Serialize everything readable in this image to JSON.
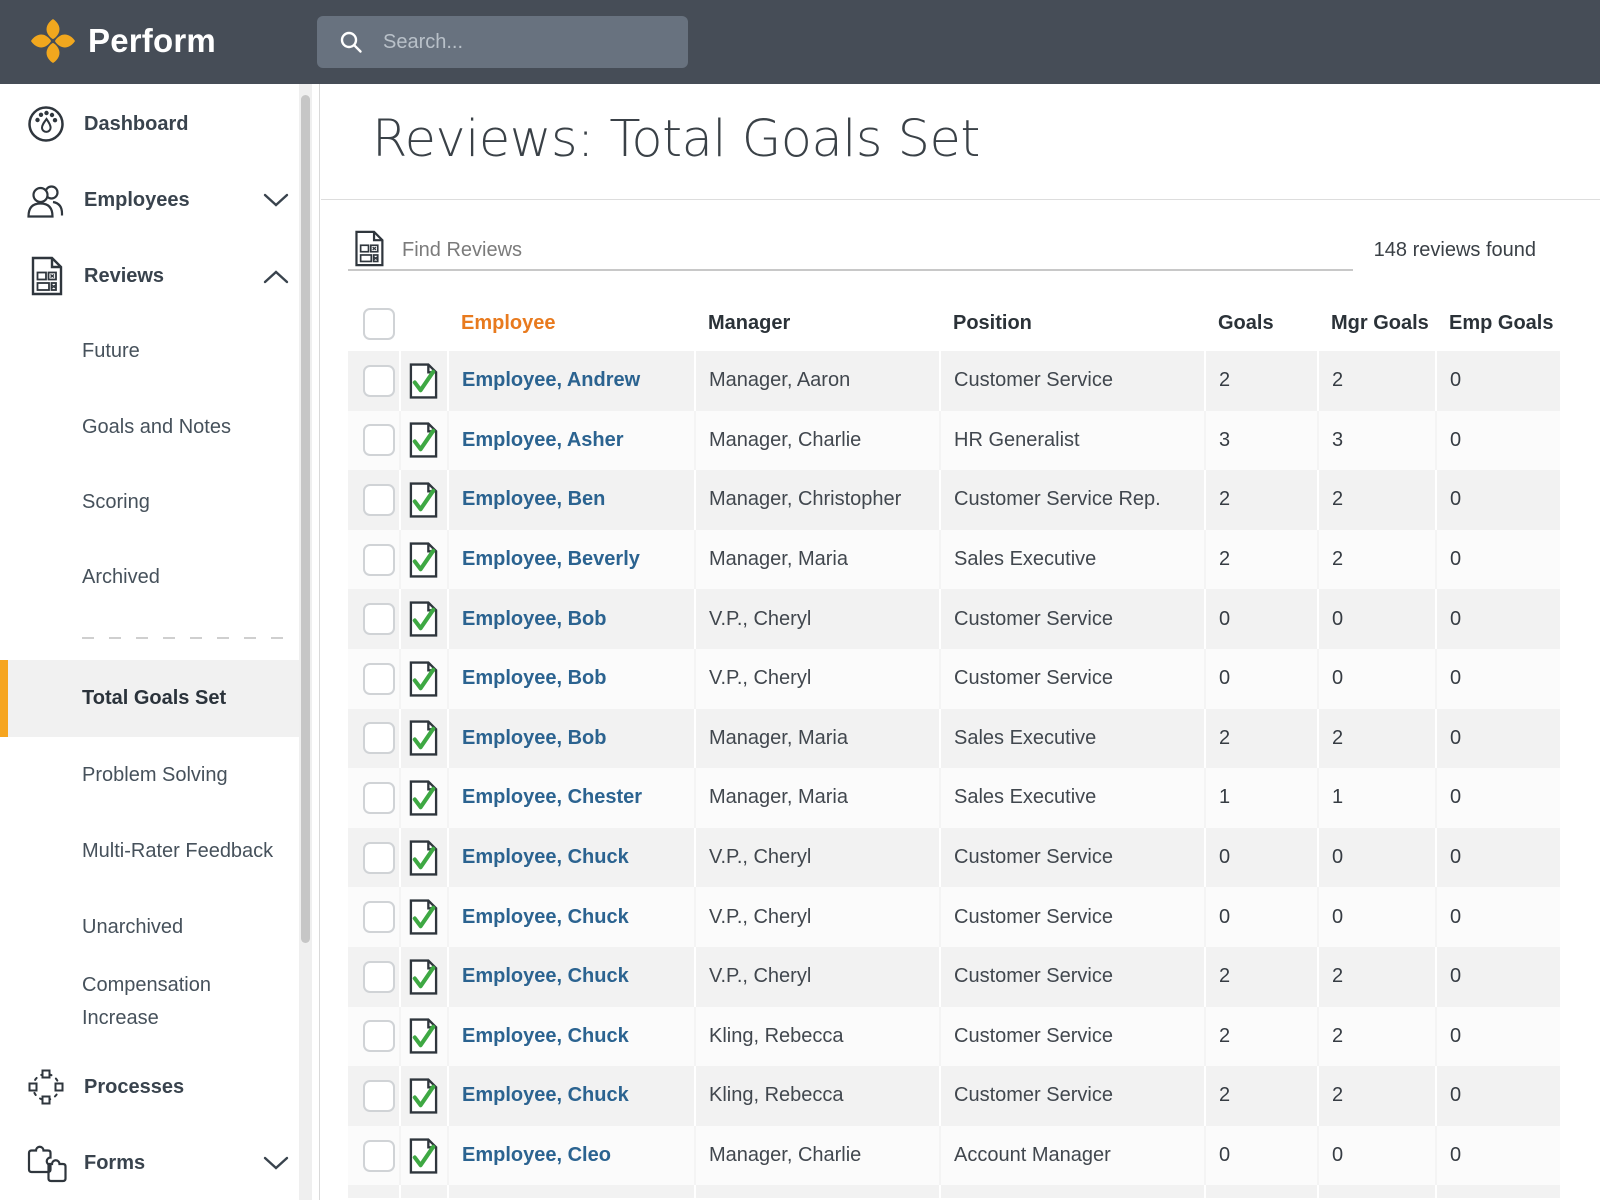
{
  "topbar": {
    "brand": "Perform",
    "search_placeholder": "Search..."
  },
  "sidebar": {
    "dashboard": "Dashboard",
    "employees": "Employees",
    "reviews": "Reviews",
    "reviews_sub": [
      "Future",
      "Goals and Notes",
      "Scoring",
      "Archived"
    ],
    "reviews_sub_lower": [
      "Total Goals Set",
      "Problem Solving",
      "Multi-Rater Feedback",
      "Unarchived",
      "Compensation Increase"
    ],
    "processes": "Processes",
    "forms": "Forms"
  },
  "main": {
    "title": "Reviews: Total Goals Set",
    "find_placeholder": "Find Reviews",
    "results_count": "148 reviews found",
    "table": {
      "headers": {
        "employee": "Employee",
        "manager": "Manager",
        "position": "Position",
        "goals": "Goals",
        "mgr_goals": "Mgr Goals",
        "emp_goals": "Emp Goals"
      },
      "rows": [
        {
          "employee": "Employee, Andrew",
          "manager": "Manager, Aaron",
          "position": "Customer Service",
          "goals": "2",
          "mgr_goals": "2",
          "emp_goals": "0"
        },
        {
          "employee": "Employee, Asher",
          "manager": "Manager, Charlie",
          "position": "HR Generalist",
          "goals": "3",
          "mgr_goals": "3",
          "emp_goals": "0"
        },
        {
          "employee": "Employee, Ben",
          "manager": "Manager, Christopher",
          "position": "Customer Service Rep.",
          "goals": "2",
          "mgr_goals": "2",
          "emp_goals": "0"
        },
        {
          "employee": "Employee, Beverly",
          "manager": "Manager, Maria",
          "position": "Sales Executive",
          "goals": "2",
          "mgr_goals": "2",
          "emp_goals": "0"
        },
        {
          "employee": "Employee, Bob",
          "manager": "V.P., Cheryl",
          "position": "Customer Service",
          "goals": "0",
          "mgr_goals": "0",
          "emp_goals": "0"
        },
        {
          "employee": "Employee, Bob",
          "manager": "V.P., Cheryl",
          "position": "Customer Service",
          "goals": "0",
          "mgr_goals": "0",
          "emp_goals": "0"
        },
        {
          "employee": "Employee, Bob",
          "manager": "Manager, Maria",
          "position": "Sales Executive",
          "goals": "2",
          "mgr_goals": "2",
          "emp_goals": "0"
        },
        {
          "employee": "Employee, Chester",
          "manager": "Manager, Maria",
          "position": "Sales Executive",
          "goals": "1",
          "mgr_goals": "1",
          "emp_goals": "0"
        },
        {
          "employee": "Employee, Chuck",
          "manager": "V.P., Cheryl",
          "position": "Customer Service",
          "goals": "0",
          "mgr_goals": "0",
          "emp_goals": "0"
        },
        {
          "employee": "Employee, Chuck",
          "manager": "V.P., Cheryl",
          "position": "Customer Service",
          "goals": "0",
          "mgr_goals": "0",
          "emp_goals": "0"
        },
        {
          "employee": "Employee, Chuck",
          "manager": "V.P., Cheryl",
          "position": "Customer Service",
          "goals": "2",
          "mgr_goals": "2",
          "emp_goals": "0"
        },
        {
          "employee": "Employee, Chuck",
          "manager": "Kling, Rebecca",
          "position": "Customer Service",
          "goals": "2",
          "mgr_goals": "2",
          "emp_goals": "0"
        },
        {
          "employee": "Employee, Chuck",
          "manager": "Kling, Rebecca",
          "position": "Customer Service",
          "goals": "2",
          "mgr_goals": "2",
          "emp_goals": "0"
        },
        {
          "employee": "Employee, Cleo",
          "manager": "Manager, Charlie",
          "position": "Account Manager",
          "goals": "0",
          "mgr_goals": "0",
          "emp_goals": "0"
        }
      ]
    }
  },
  "colors": {
    "topbar_bg": "#464D57",
    "brand_gold": "#F1A71E",
    "accent_orange": "#E87A1E",
    "active_bar_gold": "#F6A51F",
    "link_blue": "#2B6390",
    "check_green": "#3EA843",
    "row_stripe": "#F2F2F2"
  }
}
